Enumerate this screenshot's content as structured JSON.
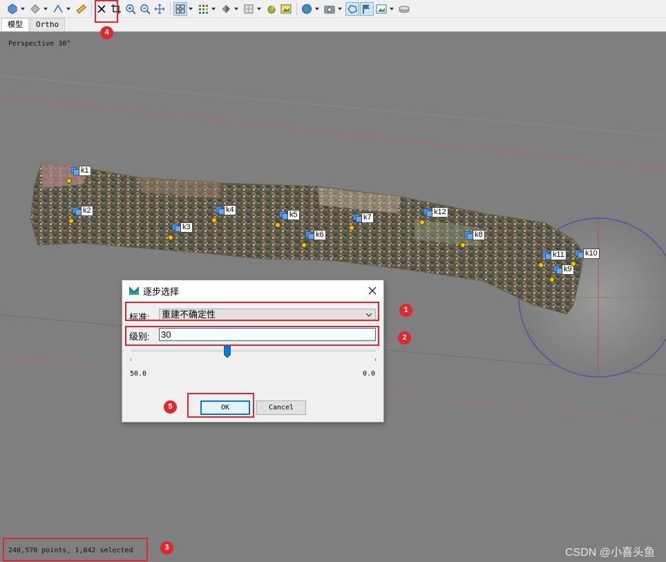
{
  "toolbar": {
    "icons": [
      "transform-icon",
      "snap-icon",
      "measure-icon",
      "ruler-icon",
      "delete-x-icon",
      "crop-icon",
      "zoom-in-icon",
      "zoom-out-icon",
      "move-icon",
      "grid-view-icon",
      "grid-dots-icon",
      "shading-icon",
      "region-icon",
      "marker-icon",
      "image-view-icon",
      "globe-icon",
      "camera-icon",
      "shape-icon",
      "flag-icon",
      "picture-icon",
      "layer-icon"
    ]
  },
  "tabs": [
    {
      "label": "模型",
      "active": true
    },
    {
      "label": "Ortho",
      "active": false
    }
  ],
  "viewport": {
    "perspective_label": "Perspective 30°",
    "status_text": "240,570 points, 1,842 selected",
    "watermark": "CSDN @小喜头鱼",
    "background_color": "#7f7f7f"
  },
  "markers": [
    "k1",
    "k2",
    "k3",
    "k4",
    "k5",
    "k6",
    "k7",
    "k8",
    "k9",
    "k10",
    "k11",
    "k12"
  ],
  "dialog": {
    "title": "逐步选择",
    "criterion_label": "标准:",
    "criterion_value": "重建不确定性",
    "level_label": "级别:",
    "level_value": "30",
    "slider_max_label": "50.0",
    "slider_min_label": "0.0",
    "slider_value": 30,
    "ok_label": "OK",
    "cancel_label": "Cancel"
  },
  "annotations": {
    "badges": [
      "1",
      "2",
      "3",
      "4",
      "5"
    ],
    "color": "#e3262b"
  }
}
